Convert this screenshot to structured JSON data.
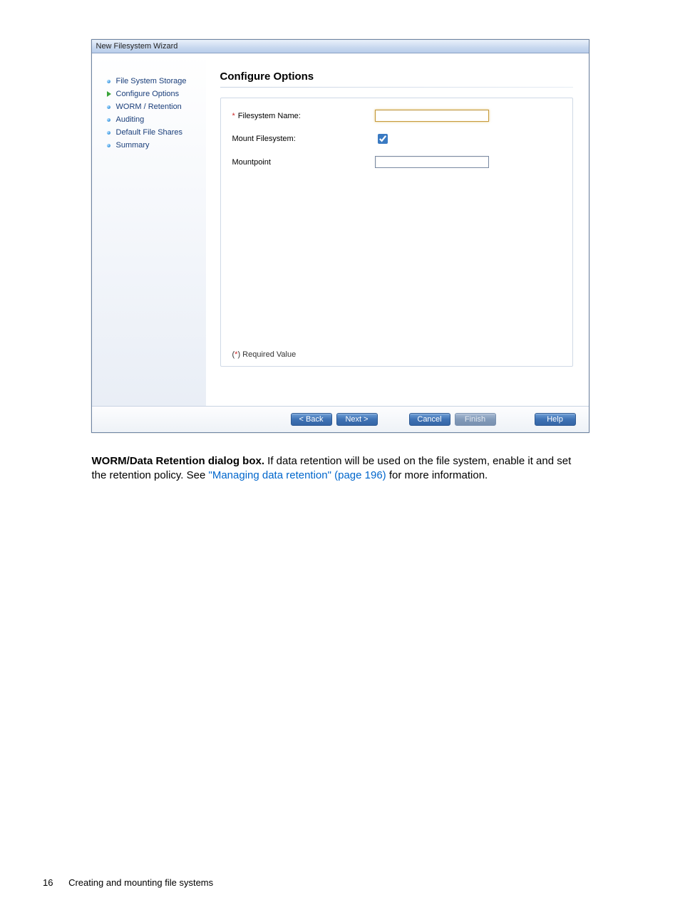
{
  "wizard": {
    "title": "New Filesystem Wizard",
    "sidebar": {
      "items": [
        {
          "label": "File System Storage",
          "current": false
        },
        {
          "label": "Configure Options",
          "current": true
        },
        {
          "label": "WORM / Retention",
          "current": false
        },
        {
          "label": "Auditing",
          "current": false
        },
        {
          "label": "Default File Shares",
          "current": false
        },
        {
          "label": "Summary",
          "current": false
        }
      ]
    },
    "main": {
      "heading": "Configure Options",
      "fields": {
        "filesystem_name": {
          "label": "Filesystem Name:",
          "required": true,
          "value": ""
        },
        "mount_filesystem": {
          "label": "Mount Filesystem:",
          "checked": true
        },
        "mountpoint": {
          "label": "Mountpoint",
          "required": false,
          "value": ""
        }
      },
      "required_note_prefix": "(",
      "required_note_star": "*",
      "required_note_suffix": ") Required Value"
    },
    "buttons": {
      "back": "< Back",
      "next": "Next >",
      "cancel": "Cancel",
      "finish": "Finish",
      "help": "Help"
    }
  },
  "caption": {
    "bold": "WORM/Data Retention dialog box.",
    "text1": " If data retention will be used on the file system, enable it and set the retention policy. See ",
    "link": "\"Managing data retention\" (page 196)",
    "text2": " for more information."
  },
  "footer": {
    "page_number": "16",
    "section": "Creating and mounting file systems"
  }
}
